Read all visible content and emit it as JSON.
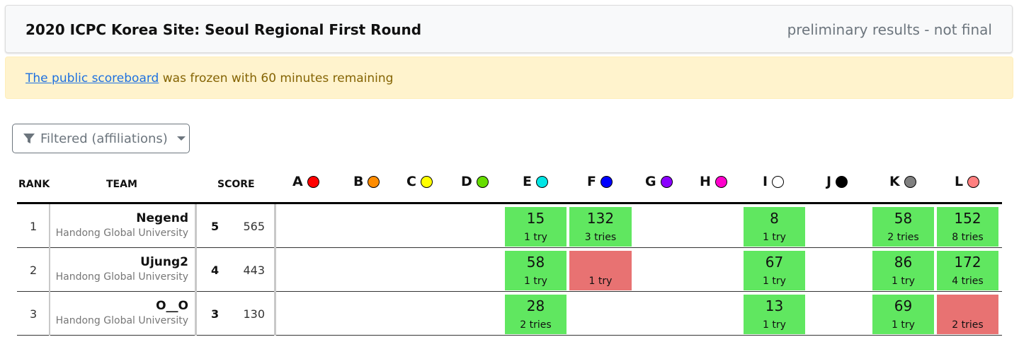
{
  "header": {
    "title": "2020 ICPC Korea Site: Seoul Regional First Round",
    "status": "preliminary results - not final"
  },
  "alert": {
    "link_text": "The public scoreboard",
    "text": " was frozen with 60 minutes remaining"
  },
  "filter": {
    "label": "Filtered (affiliations)",
    "icon": "filter-icon"
  },
  "columns": {
    "rank": "RANK",
    "team": "TEAM",
    "score": "SCORE"
  },
  "problems": [
    {
      "label": "A",
      "color": "#ff0000"
    },
    {
      "label": "B",
      "color": "#ff8c00"
    },
    {
      "label": "C",
      "color": "#ffff00"
    },
    {
      "label": "D",
      "color": "#66dd00"
    },
    {
      "label": "E",
      "color": "#00e5e5"
    },
    {
      "label": "F",
      "color": "#0000ff"
    },
    {
      "label": "G",
      "color": "#8a00ff"
    },
    {
      "label": "H",
      "color": "#ff00cc"
    },
    {
      "label": "I",
      "color": "#ffffff"
    },
    {
      "label": "J",
      "color": "#000000"
    },
    {
      "label": "K",
      "color": "#808080"
    },
    {
      "label": "L",
      "color": "#ff8080"
    }
  ],
  "status_colors": {
    "correct": "#60e760",
    "incorrect": "#e87272"
  },
  "teams": [
    {
      "rank": "1",
      "name": "Negend",
      "affiliation": "Handong Global University",
      "solved": "5",
      "penalty": "565",
      "cells": [
        {
          "problem": "E",
          "status": "correct",
          "time": "15",
          "tries": "1 try"
        },
        {
          "problem": "F",
          "status": "correct",
          "time": "132",
          "tries": "3 tries"
        },
        {
          "problem": "I",
          "status": "correct",
          "time": "8",
          "tries": "1 try"
        },
        {
          "problem": "K",
          "status": "correct",
          "time": "58",
          "tries": "2 tries"
        },
        {
          "problem": "L",
          "status": "correct",
          "time": "152",
          "tries": "8 tries"
        }
      ]
    },
    {
      "rank": "2",
      "name": "Ujung2",
      "affiliation": "Handong Global University",
      "solved": "4",
      "penalty": "443",
      "cells": [
        {
          "problem": "E",
          "status": "correct",
          "time": "58",
          "tries": "1 try"
        },
        {
          "problem": "F",
          "status": "incorrect",
          "time": "",
          "tries": "1 try"
        },
        {
          "problem": "I",
          "status": "correct",
          "time": "67",
          "tries": "1 try"
        },
        {
          "problem": "K",
          "status": "correct",
          "time": "86",
          "tries": "1 try"
        },
        {
          "problem": "L",
          "status": "correct",
          "time": "172",
          "tries": "4 tries"
        }
      ]
    },
    {
      "rank": "3",
      "name": "O__O",
      "affiliation": "Handong Global University",
      "solved": "3",
      "penalty": "130",
      "cells": [
        {
          "problem": "E",
          "status": "correct",
          "time": "28",
          "tries": "2 tries"
        },
        {
          "problem": "I",
          "status": "correct",
          "time": "13",
          "tries": "1 try"
        },
        {
          "problem": "K",
          "status": "correct",
          "time": "69",
          "tries": "1 try"
        },
        {
          "problem": "L",
          "status": "incorrect",
          "time": "",
          "tries": "2 tries"
        }
      ]
    }
  ]
}
